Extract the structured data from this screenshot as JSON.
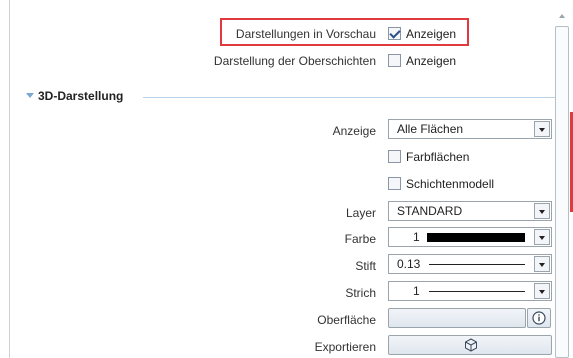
{
  "top": {
    "preview_label": "Darstellungen in Vorschau",
    "preview_checkbox_label": "Anzeigen",
    "upper_layers_label": "Darstellung der Oberschichten",
    "upper_layers_checkbox_label": "Anzeigen"
  },
  "section": {
    "title": "3D-Darstellung"
  },
  "fields": {
    "anzeige_label": "Anzeige",
    "anzeige_value": "Alle Flächen",
    "farbflaechen_label": "Farbflächen",
    "schichtenmodell_label": "Schichtenmodell",
    "layer_label": "Layer",
    "layer_value": "STANDARD",
    "farbe_label": "Farbe",
    "farbe_value": "1",
    "stift_label": "Stift",
    "stift_value": "0.13",
    "strich_label": "Strich",
    "strich_value": "1",
    "oberflaeche_label": "Oberfläche",
    "exportieren_label": "Exportieren"
  },
  "states": {
    "preview_checked": true,
    "upper_layers_checked": false,
    "farbflaechen_checked": false,
    "schichtenmodell_checked": false
  },
  "colors": {
    "highlight": "#e0393e",
    "farbe_swatch": "#000000"
  },
  "icons": {
    "info": "info-icon",
    "cube": "cube-icon"
  }
}
